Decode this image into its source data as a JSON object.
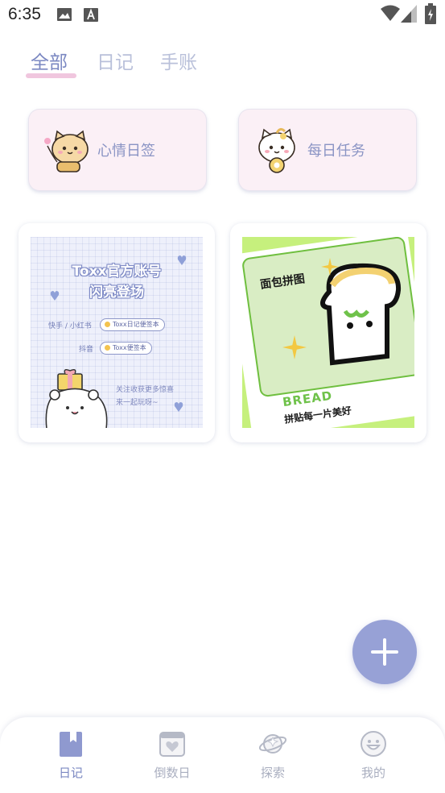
{
  "status_bar": {
    "time": "6:35",
    "icons": [
      "image-icon",
      "a-text-icon",
      "wifi-icon",
      "signal-icon",
      "battery-icon"
    ]
  },
  "tabs": [
    {
      "label": "全部",
      "active": true
    },
    {
      "label": "日记",
      "active": false
    },
    {
      "label": "手账",
      "active": false
    }
  ],
  "quick_cards": [
    {
      "label": "心情日签",
      "icon": "cat-mascot-icon"
    },
    {
      "label": "每日任务",
      "icon": "cat-mascot-icon"
    }
  ],
  "content_cards": [
    {
      "title_line1": "Toxx官方账号",
      "title_line2": "闪亮登场",
      "rows": [
        {
          "label": "快手 / 小红书",
          "pill": "Toxx日记便签本"
        },
        {
          "label": "抖音",
          "pill": "Toxx便签本"
        }
      ],
      "footer_line1": "关注收获更多惊喜",
      "footer_line2": "来一起玩呀~"
    },
    {
      "title": "面包拼图",
      "brand": "BREAD",
      "slogan": "拼贴每一片美好"
    }
  ],
  "fab": {
    "icon": "plus-icon"
  },
  "bottom_nav": [
    {
      "label": "日记",
      "icon": "book-icon",
      "active": true
    },
    {
      "label": "倒数日",
      "icon": "calendar-heart-icon",
      "active": false
    },
    {
      "label": "探索",
      "icon": "planet-icon",
      "active": false
    },
    {
      "label": "我的",
      "icon": "smiley-icon",
      "active": false
    }
  ],
  "colors": {
    "accent": "#7b88c2",
    "tab_inactive": "#b9c0da",
    "tab_indicator": "#f0c6de",
    "quick_card_bg": "#fbf0f6",
    "fab": "#97a1d6",
    "nav_inactive": "#a9aebf"
  }
}
